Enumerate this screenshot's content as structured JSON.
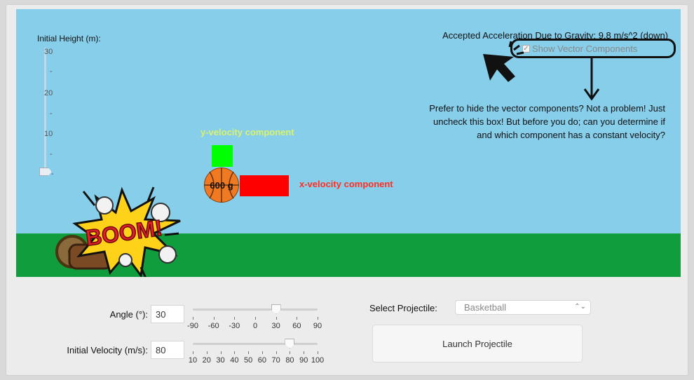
{
  "scene": {
    "height_title": "Initial Height (m):",
    "height_ticks": [
      "30",
      "20",
      "10"
    ],
    "gravity_text": "Accepted Acceleration Due to Gravity: 9.8 m/s^2 (down)",
    "show_vectors_label": "Show Vector Components",
    "show_vectors_checked": true,
    "note_lines": [
      "Prefer to hide the vector components? Not a problem! Just",
      "uncheck this box! But before you do; can you determine if",
      "and which component has a constant velocity?"
    ],
    "y_velocity_label": "y-velocity component",
    "x_velocity_label": "x-velocity component",
    "projectile_mass": "600 g",
    "boom_text": "BOOM!",
    "colors": {
      "sky": "#87ceeb",
      "ground": "#0f9d3e",
      "y_vector": "#00ff00",
      "x_vector": "#ff0000",
      "ball": "#f07a22"
    }
  },
  "controls": {
    "angle_label": "Angle (°):",
    "angle_value": "30",
    "angle_ticks": [
      "-90",
      "-60",
      "-30",
      "0",
      "30",
      "60",
      "90"
    ],
    "angle_range": [
      -90,
      90
    ],
    "angle_slider_value": 30,
    "velocity_label": "Initial Velocity (m/s):",
    "velocity_value": "80",
    "velocity_ticks": [
      "10",
      "20",
      "30",
      "40",
      "50",
      "60",
      "70",
      "80",
      "90",
      "100"
    ],
    "velocity_range": [
      10,
      100
    ],
    "velocity_slider_value": 80,
    "select_label": "Select Projectile:",
    "select_value": "Basketball",
    "launch_label": "Launch Projectile"
  }
}
